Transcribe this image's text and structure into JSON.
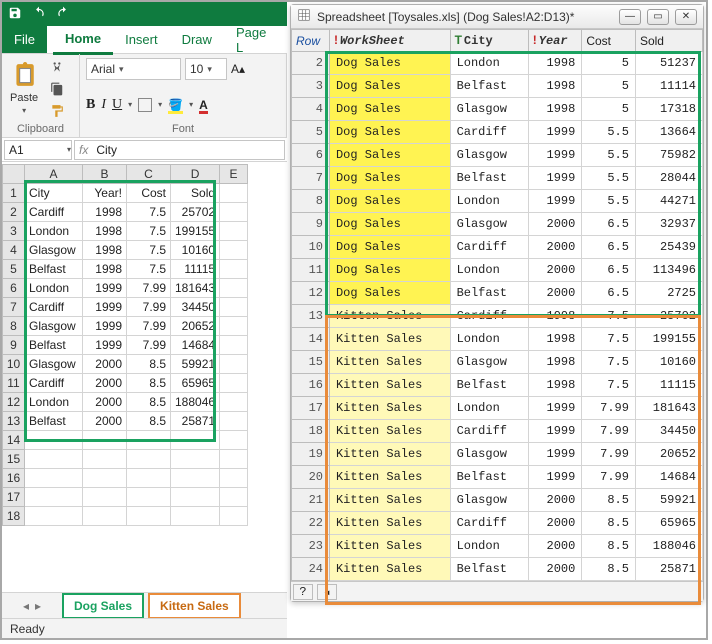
{
  "excel": {
    "menus": {
      "file": "File",
      "home": "Home",
      "insert": "Insert",
      "draw": "Draw",
      "pagelayout": "Page L"
    },
    "paste_label": "Paste",
    "clipboard_label": "Clipboard",
    "font_group_label": "Font",
    "font_name": "Arial",
    "font_size": "10",
    "namebox": "A1",
    "fx_label": "fx",
    "formula_value": "City",
    "columns": [
      "A",
      "B",
      "C",
      "D",
      "E"
    ],
    "headers": {
      "A": "City",
      "B": "Year!",
      "C": "Cost",
      "D": "Sold"
    },
    "rows": [
      {
        "n": "2",
        "A": "Cardiff",
        "B": "1998",
        "C": "7.5",
        "D": "25702"
      },
      {
        "n": "3",
        "A": "London",
        "B": "1998",
        "C": "7.5",
        "D": "199155"
      },
      {
        "n": "4",
        "A": "Glasgow",
        "B": "1998",
        "C": "7.5",
        "D": "10160"
      },
      {
        "n": "5",
        "A": "Belfast",
        "B": "1998",
        "C": "7.5",
        "D": "11115"
      },
      {
        "n": "6",
        "A": "London",
        "B": "1999",
        "C": "7.99",
        "D": "181643"
      },
      {
        "n": "7",
        "A": "Cardiff",
        "B": "1999",
        "C": "7.99",
        "D": "34450"
      },
      {
        "n": "8",
        "A": "Glasgow",
        "B": "1999",
        "C": "7.99",
        "D": "20652"
      },
      {
        "n": "9",
        "A": "Belfast",
        "B": "1999",
        "C": "7.99",
        "D": "14684"
      },
      {
        "n": "10",
        "A": "Glasgow",
        "B": "2000",
        "C": "8.5",
        "D": "59921"
      },
      {
        "n": "11",
        "A": "Cardiff",
        "B": "2000",
        "C": "8.5",
        "D": "65965"
      },
      {
        "n": "12",
        "A": "London",
        "B": "2000",
        "C": "8.5",
        "D": "188046"
      },
      {
        "n": "13",
        "A": "Belfast",
        "B": "2000",
        "C": "8.5",
        "D": "25871"
      }
    ],
    "empty_rows": [
      "14",
      "15",
      "16",
      "17",
      "18"
    ],
    "tabs": {
      "dog": "Dog Sales",
      "kitten": "Kitten Sales"
    },
    "status": "Ready"
  },
  "dwin": {
    "title": "Spreadsheet [Toysales.xls] (Dog Sales!A2:D13)*",
    "cols": {
      "row": "Row",
      "ws": "WorkSheet",
      "city": "City",
      "year": "Year",
      "cost": "Cost",
      "sold": "Sold"
    },
    "rows": [
      {
        "n": "2",
        "ws": "Dog Sales",
        "city": "London",
        "year": "1998",
        "cost": "5",
        "sold": "51237",
        "g": "dog"
      },
      {
        "n": "3",
        "ws": "Dog Sales",
        "city": "Belfast",
        "year": "1998",
        "cost": "5",
        "sold": "11114",
        "g": "dog"
      },
      {
        "n": "4",
        "ws": "Dog Sales",
        "city": "Glasgow",
        "year": "1998",
        "cost": "5",
        "sold": "17318",
        "g": "dog"
      },
      {
        "n": "5",
        "ws": "Dog Sales",
        "city": "Cardiff",
        "year": "1999",
        "cost": "5.5",
        "sold": "13664",
        "g": "dog"
      },
      {
        "n": "6",
        "ws": "Dog Sales",
        "city": "Glasgow",
        "year": "1999",
        "cost": "5.5",
        "sold": "75982",
        "g": "dog"
      },
      {
        "n": "7",
        "ws": "Dog Sales",
        "city": "Belfast",
        "year": "1999",
        "cost": "5.5",
        "sold": "28044",
        "g": "dog"
      },
      {
        "n": "8",
        "ws": "Dog Sales",
        "city": "London",
        "year": "1999",
        "cost": "5.5",
        "sold": "44271",
        "g": "dog"
      },
      {
        "n": "9",
        "ws": "Dog Sales",
        "city": "Glasgow",
        "year": "2000",
        "cost": "6.5",
        "sold": "32937",
        "g": "dog"
      },
      {
        "n": "10",
        "ws": "Dog Sales",
        "city": "Cardiff",
        "year": "2000",
        "cost": "6.5",
        "sold": "25439",
        "g": "dog"
      },
      {
        "n": "11",
        "ws": "Dog Sales",
        "city": "London",
        "year": "2000",
        "cost": "6.5",
        "sold": "113496",
        "g": "dog"
      },
      {
        "n": "12",
        "ws": "Dog Sales",
        "city": "Belfast",
        "year": "2000",
        "cost": "6.5",
        "sold": "2725",
        "g": "dog"
      },
      {
        "n": "13",
        "ws": "Kitten Sales",
        "city": "Cardiff",
        "year": "1998",
        "cost": "7.5",
        "sold": "25702",
        "g": "kit"
      },
      {
        "n": "14",
        "ws": "Kitten Sales",
        "city": "London",
        "year": "1998",
        "cost": "7.5",
        "sold": "199155",
        "g": "kit"
      },
      {
        "n": "15",
        "ws": "Kitten Sales",
        "city": "Glasgow",
        "year": "1998",
        "cost": "7.5",
        "sold": "10160",
        "g": "kit"
      },
      {
        "n": "16",
        "ws": "Kitten Sales",
        "city": "Belfast",
        "year": "1998",
        "cost": "7.5",
        "sold": "11115",
        "g": "kit"
      },
      {
        "n": "17",
        "ws": "Kitten Sales",
        "city": "London",
        "year": "1999",
        "cost": "7.99",
        "sold": "181643",
        "g": "kit"
      },
      {
        "n": "18",
        "ws": "Kitten Sales",
        "city": "Cardiff",
        "year": "1999",
        "cost": "7.99",
        "sold": "34450",
        "g": "kit"
      },
      {
        "n": "19",
        "ws": "Kitten Sales",
        "city": "Glasgow",
        "year": "1999",
        "cost": "7.99",
        "sold": "20652",
        "g": "kit"
      },
      {
        "n": "20",
        "ws": "Kitten Sales",
        "city": "Belfast",
        "year": "1999",
        "cost": "7.99",
        "sold": "14684",
        "g": "kit"
      },
      {
        "n": "21",
        "ws": "Kitten Sales",
        "city": "Glasgow",
        "year": "2000",
        "cost": "8.5",
        "sold": "59921",
        "g": "kit"
      },
      {
        "n": "22",
        "ws": "Kitten Sales",
        "city": "Cardiff",
        "year": "2000",
        "cost": "8.5",
        "sold": "65965",
        "g": "kit"
      },
      {
        "n": "23",
        "ws": "Kitten Sales",
        "city": "London",
        "year": "2000",
        "cost": "8.5",
        "sold": "188046",
        "g": "kit"
      },
      {
        "n": "24",
        "ws": "Kitten Sales",
        "city": "Belfast",
        "year": "2000",
        "cost": "8.5",
        "sold": "25871",
        "g": "kit"
      }
    ],
    "help": "?"
  }
}
